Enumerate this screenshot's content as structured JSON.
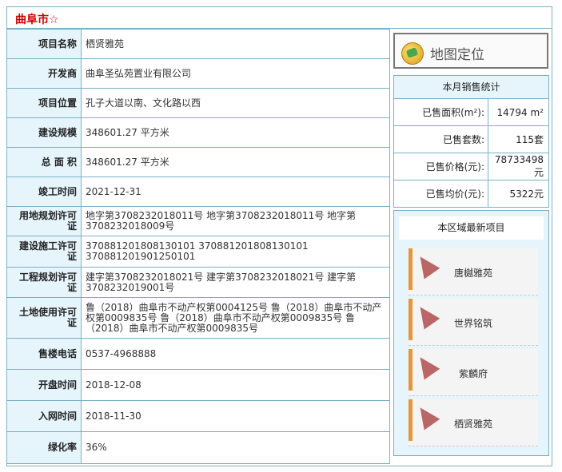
{
  "header": {
    "title": "曲阜市☆"
  },
  "info_rows": [
    {
      "label": "项目名称",
      "value": "栖贤雅苑"
    },
    {
      "label": "开发商",
      "value": "曲阜圣弘苑置业有限公司"
    },
    {
      "label": "项目位置",
      "value": "孔子大道以南、文化路以西"
    },
    {
      "label": "建设规模",
      "value": "348601.27 平方米"
    },
    {
      "label": "总 面 积",
      "value": "348601.27 平方米"
    },
    {
      "label": "竣工时间",
      "value": "2021-12-31"
    },
    {
      "label": "用地规划许可证",
      "value": "地字第3708232018011号 地字第3708232018011号 地字第3708232018009号"
    },
    {
      "label": "建设施工许可证",
      "value": "370881201808130101 370881201808130101 370881201901250101"
    },
    {
      "label": "工程规划许可证",
      "value": "建字第3708232018021号 建字第3708232018021号 建字第3708232019001号"
    },
    {
      "label": "土地使用许可证",
      "value": "鲁（2018）曲阜市不动产权第0004125号 鲁（2018）曲阜市不动产权第0009835号 鲁（2018）曲阜市不动产权第0009835号 鲁（2018）曲阜市不动产权第0009835号"
    },
    {
      "label": "售楼电话",
      "value": "0537-4968888"
    },
    {
      "label": "开盘时间",
      "value": "2018-12-08"
    },
    {
      "label": "入网时间",
      "value": "2018-11-30"
    },
    {
      "label": "绿化率",
      "value": "36%"
    }
  ],
  "map_button": {
    "label": "地图定位"
  },
  "sales": {
    "title": "本月销售统计",
    "rows": [
      {
        "label": "已售面积(m²):",
        "value": "14794 m²"
      },
      {
        "label": "已售套数:",
        "value": "115套"
      },
      {
        "label": "已售价格(元):",
        "value": "78733498元"
      },
      {
        "label": "已售均价(元):",
        "value": "5322元"
      }
    ]
  },
  "area": {
    "title": "本区域最新项目",
    "projects": [
      "唐樾雅苑",
      "世界铭筑",
      "紫麟府",
      "栖贤雅苑"
    ]
  }
}
